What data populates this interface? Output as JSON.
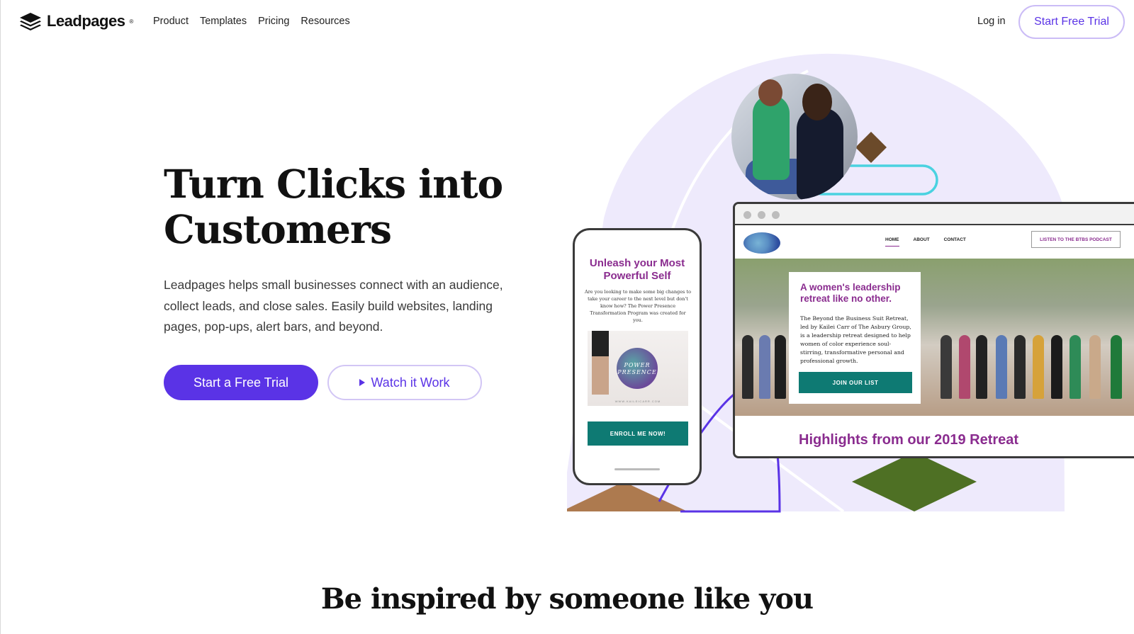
{
  "brand": {
    "name": "Leadpages",
    "registered": "®"
  },
  "nav": {
    "items": [
      "Product",
      "Templates",
      "Pricing",
      "Resources"
    ]
  },
  "header": {
    "login": "Log in",
    "cta": "Start Free Trial"
  },
  "hero": {
    "title": "Turn Clicks into Customers",
    "subtitle": "Leadpages helps small businesses connect with an audience, collect leads, and close sales. Easily build websites, landing pages, pop-ups, alert bars, and beyond.",
    "primary_cta": "Start a Free Trial",
    "secondary_cta": "Watch it Work"
  },
  "phone_mockup": {
    "title": "Unleash your Most Powerful Self",
    "copy": "Are you looking to make some big changes to take your career to the next level but don't know how? The Power Presence Transformation Program was created for you.",
    "image_text": "POWER PRESENCE",
    "image_site": "WWW.KAILEICARR.COM",
    "button": "ENROLL ME NOW!"
  },
  "browser_mockup": {
    "nav": [
      "HOME",
      "ABOUT",
      "CONTACT"
    ],
    "podcast_button": "LISTEN TO THE BTBS PODCAST",
    "card_title": "A women's leadership retreat like no other.",
    "card_copy": "The Beyond the Business Suit Retreat, led by Kailei Carr of The Asbury Group, is a leadership retreat designed to help women of color experience soul-stirring, transformative personal and professional growth.",
    "card_button": "JOIN OUR LIST",
    "highlights": "Highlights from our 2019 Retreat"
  },
  "section": {
    "title": "Be inspired by someone like you"
  },
  "colors": {
    "accent": "#5a33e6",
    "accent_border": "#cbbcf6",
    "lavender_bg": "#eeeafc",
    "teal": "#0e7a73",
    "plum": "#8a2c8f",
    "green_diamond": "#4e7024",
    "brown_diamond": "#6b4a2a",
    "cyan_pill": "#4ad2e0"
  },
  "icons": {
    "logo": "stacked-layers-icon",
    "play": "play-icon"
  }
}
